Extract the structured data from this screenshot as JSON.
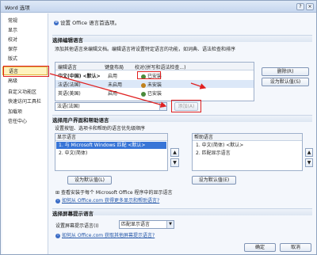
{
  "window": {
    "title": "Word 选项",
    "help_label": "?",
    "close_label": "×"
  },
  "nav": {
    "items": [
      {
        "label": "常规"
      },
      {
        "label": "显示"
      },
      {
        "label": "校对"
      },
      {
        "label": "保存"
      },
      {
        "label": "版式"
      },
      {
        "label": "语言"
      },
      {
        "label": "高级"
      },
      {
        "label": "自定义功能区"
      },
      {
        "label": "快速访问工具栏"
      },
      {
        "label": "加载项"
      },
      {
        "label": "信任中心"
      }
    ],
    "selected": "语言"
  },
  "header": {
    "text": "设置 Office 语言首选项。"
  },
  "editing": {
    "section_title": "选择编辑语言",
    "description": "添加其他语言来编辑文档。编辑语言将设置特定语言的功能，如词典、语法检查和排序",
    "columns": [
      "编辑语言",
      "键盘布局",
      "校对(拼写和语法检查...)"
    ],
    "rows": [
      {
        "language": "中文(中国) <默认>",
        "keyboard": "启用",
        "proofing": "已安装"
      },
      {
        "language": "法语(法国)",
        "keyboard": "未启用",
        "proofing": "未安装"
      },
      {
        "language": "英语(美国)",
        "keyboard": "启用",
        "proofing": "已安装"
      }
    ],
    "remove_label": "删除(R)",
    "default_label": "设为默认值(S)",
    "add_combo_value": "法语(法国)",
    "add_label": "添加(A)"
  },
  "display": {
    "section_title": "选择用户界面和帮助语言",
    "description": "设置按钮、选项卡和帮助的语言优先级顺序",
    "display_header": "显示语言",
    "display_items": [
      "1.  与 Microsoft Windows 匹配 <默认>",
      "2.  中文(简体)"
    ],
    "help_header": "帮助语言",
    "help_items": [
      "1.  中文(简体) <默认>",
      "2.  匹配显示语言"
    ],
    "up_label": "▲",
    "down_label": "▼",
    "default_label_left": "设为默认值(L)",
    "default_label_right": "设为默认值(E)",
    "view_text": "查看安装于每个 Microsoft Office 程序中的显示语言",
    "link_text": "如何从 Office.com 获得更多显示和帮助语言?"
  },
  "screentip": {
    "section_title": "选择屏幕提示语言",
    "label": "设置屏幕提示语言(I)",
    "value": "匹配显示语言",
    "link_text": "如何从 Office.com 获取其他屏幕提示语言?"
  },
  "footer": {
    "ok_label": "确定",
    "cancel_label": "取消"
  }
}
